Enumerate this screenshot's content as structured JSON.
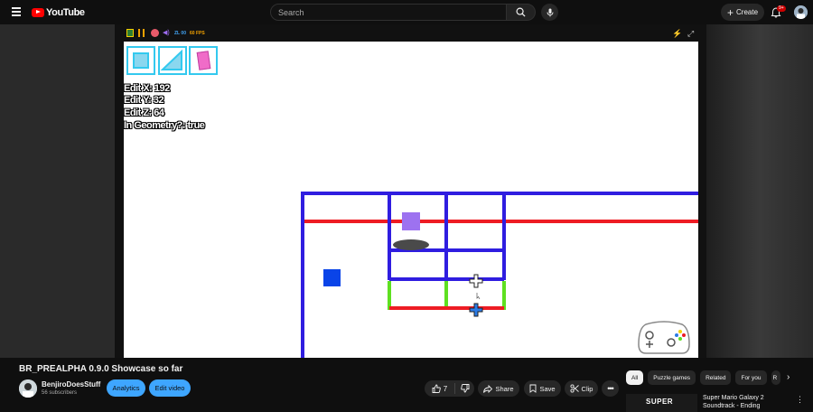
{
  "header": {
    "logo_text": "YouTube",
    "search_placeholder": "Search",
    "create_label": "Create",
    "notification_badge": "9+"
  },
  "player": {
    "controls": {
      "text1": "ZL 00",
      "text2": "60 FPS"
    },
    "stage": {
      "info_lines": [
        "Edit X: 192",
        "Edit Y: 32",
        "Edit Z: 64",
        "In Geometry?: true"
      ]
    }
  },
  "video": {
    "title": "BR_PREALPHA 0.9.0 Showcase so far",
    "channel_name": "BenjiroDoesStuff",
    "subscribers": "56 subscribers",
    "analytics_label": "Analytics",
    "edit_label": "Edit video",
    "like_count": "7",
    "share_label": "Share",
    "save_label": "Save",
    "clip_label": "Clip"
  },
  "sidebar": {
    "chips": [
      "All",
      "Puzzle games",
      "Related",
      "For you",
      "R"
    ],
    "recommendation": {
      "thumb_text": "SUPER",
      "title": "Super Mario Galaxy 2 Soundtrack - Ending"
    }
  },
  "colors": {
    "accent_blue": "#3ea6ff",
    "brand_red": "#ff0000",
    "level_blue": "#2f1de0",
    "level_red": "#ee1c24",
    "level_green": "#5ee020"
  }
}
